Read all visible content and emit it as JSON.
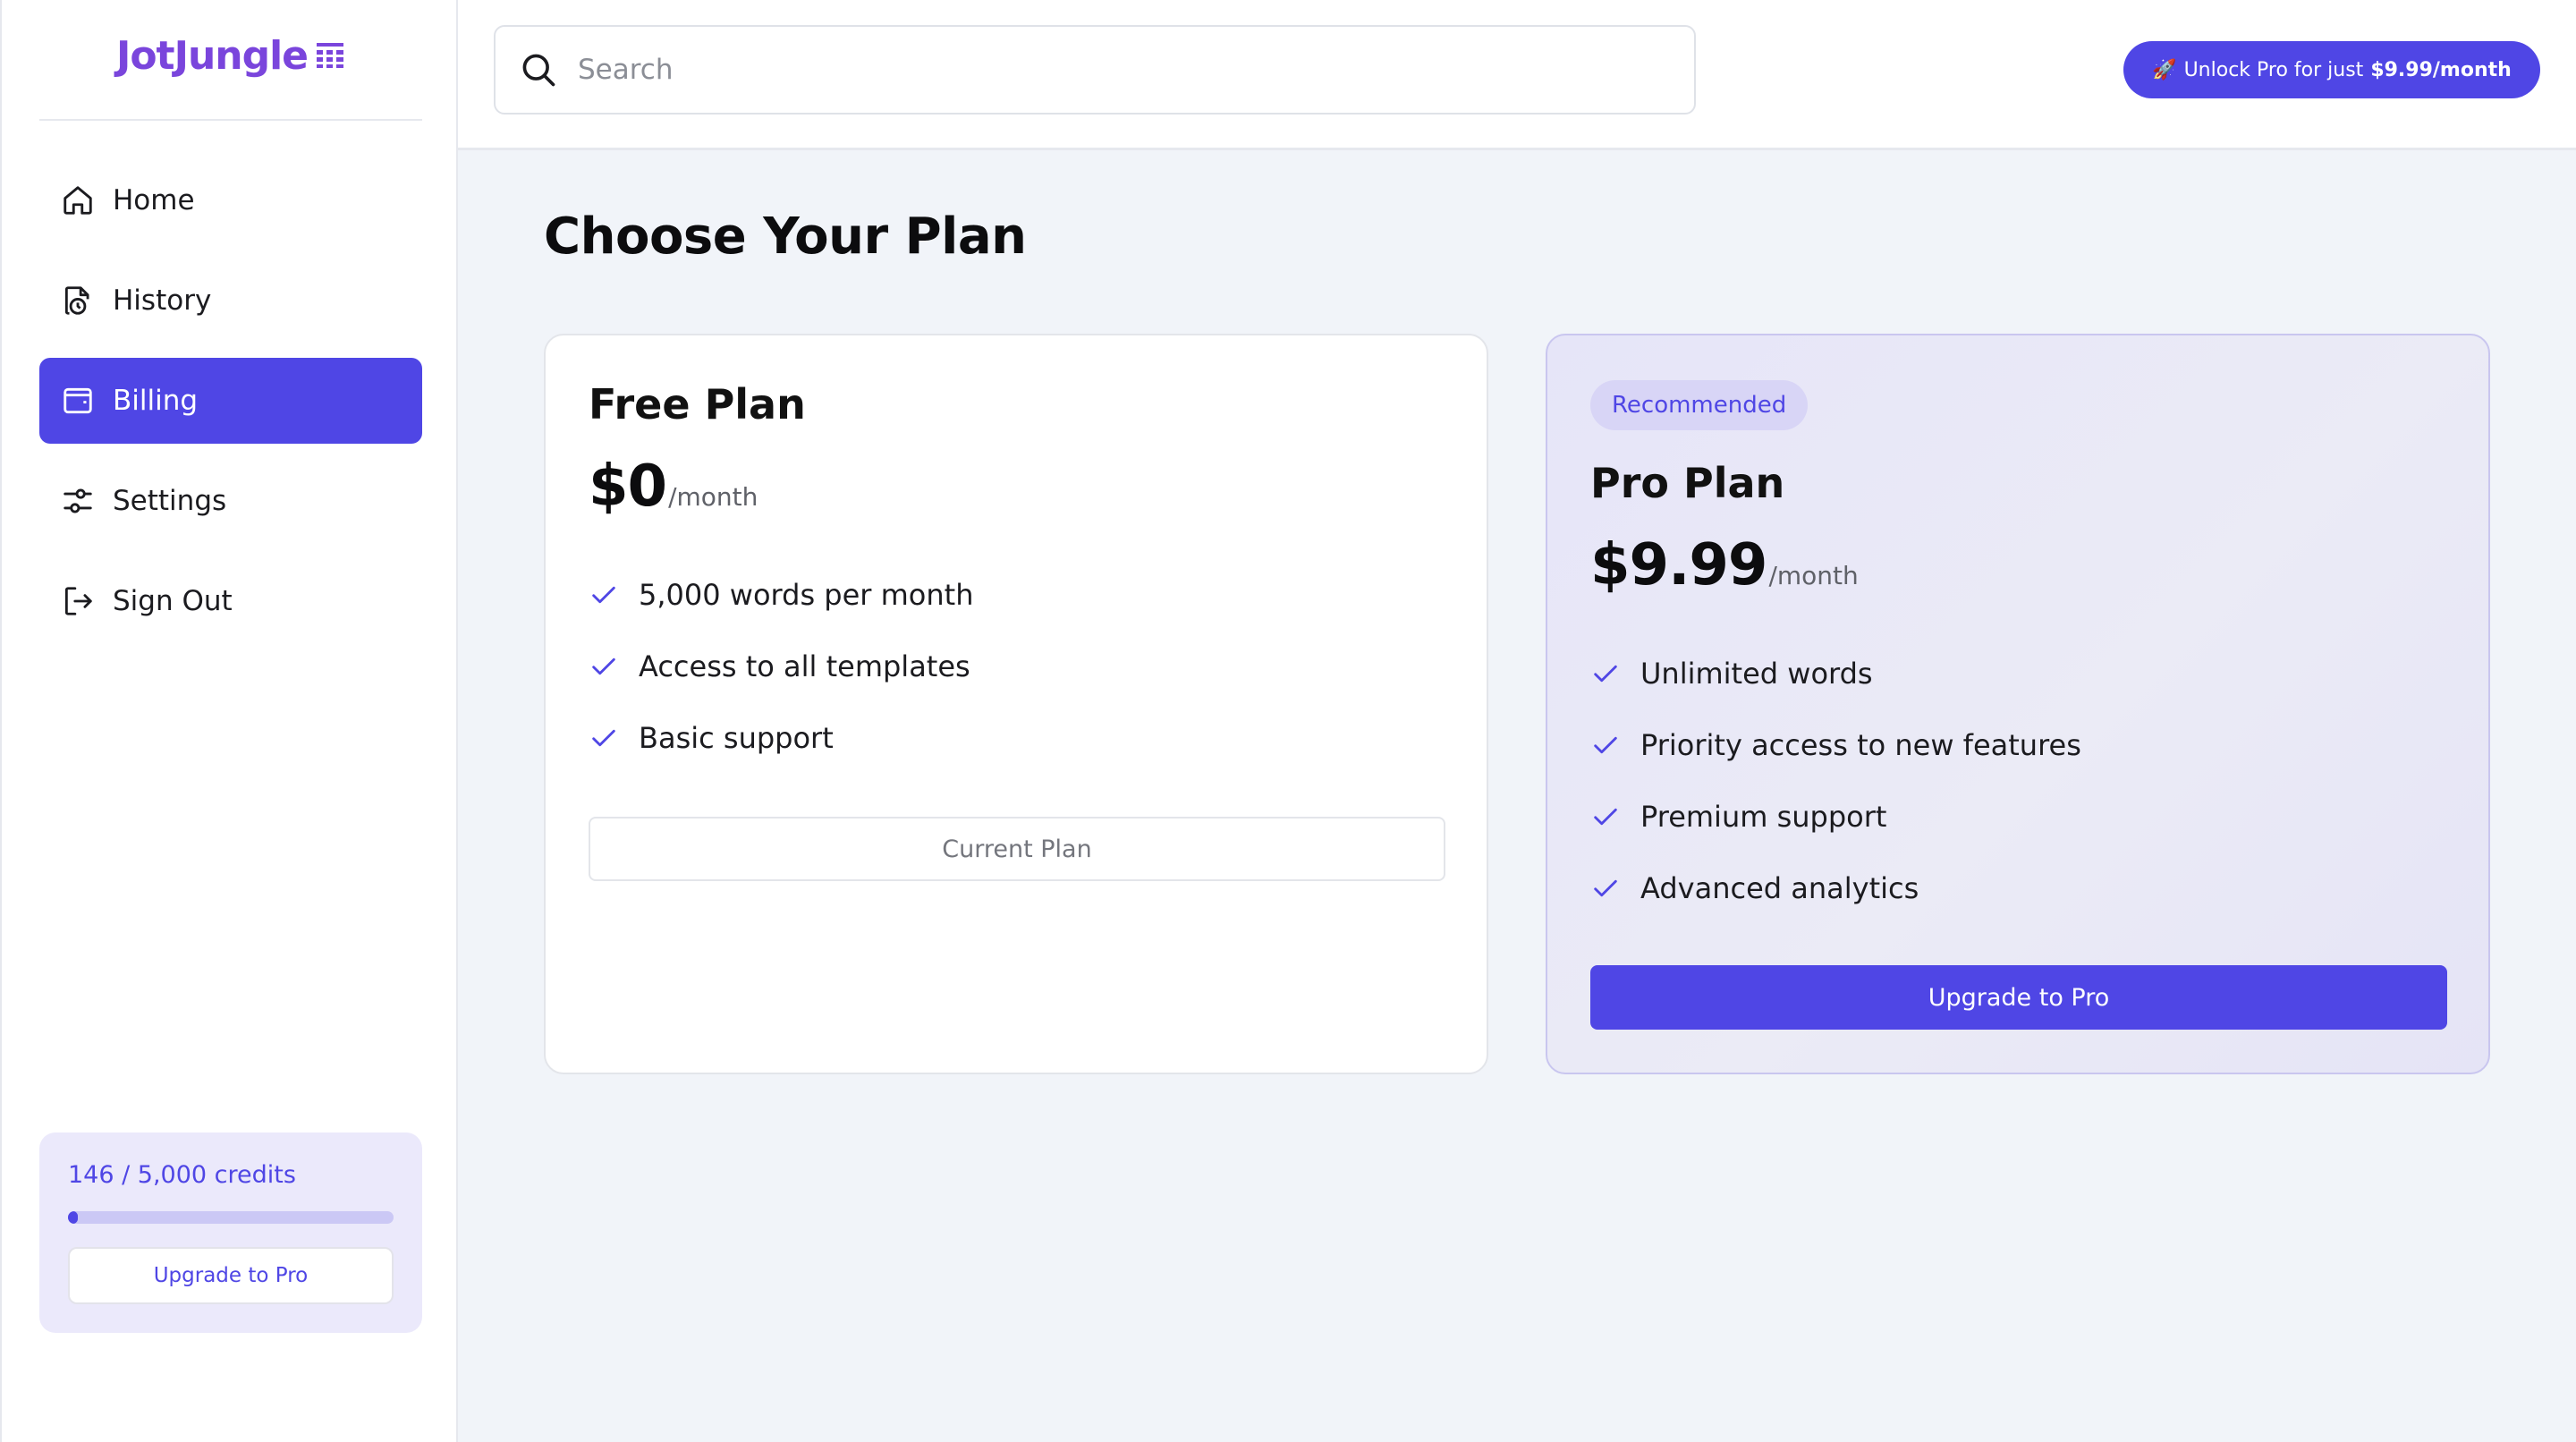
{
  "app": {
    "name": "JotJungle"
  },
  "sidebar": {
    "items": [
      {
        "label": "Home",
        "icon": "home-icon",
        "active": false
      },
      {
        "label": "History",
        "icon": "history-icon",
        "active": false
      },
      {
        "label": "Billing",
        "icon": "wallet-icon",
        "active": true
      },
      {
        "label": "Settings",
        "icon": "sliders-icon",
        "active": false
      },
      {
        "label": "Sign Out",
        "icon": "sign-out-icon",
        "active": false
      }
    ],
    "credits": {
      "text": "146 / 5,000 credits",
      "used": 146,
      "total": 5000,
      "button_label": "Upgrade to Pro"
    }
  },
  "header": {
    "search_placeholder": "Search",
    "unlock": {
      "emoji": "🚀",
      "prefix": "Unlock Pro for just",
      "price": "$9.99/month"
    }
  },
  "main": {
    "title": "Choose Your Plan",
    "plans": [
      {
        "name": "Free Plan",
        "price": "$0",
        "period": "/month",
        "features": [
          "5,000 words per month",
          "Access to all templates",
          "Basic support"
        ],
        "button_label": "Current Plan"
      },
      {
        "badge": "Recommended",
        "name": "Pro Plan",
        "price": "$9.99",
        "period": "/month",
        "features": [
          "Unlimited words",
          "Priority access to new features",
          "Premium support",
          "Advanced analytics"
        ],
        "button_label": "Upgrade to Pro"
      }
    ]
  },
  "colors": {
    "accent": "#4f46e5",
    "logo": "#7a45dc",
    "background": "#f1f4f9"
  }
}
